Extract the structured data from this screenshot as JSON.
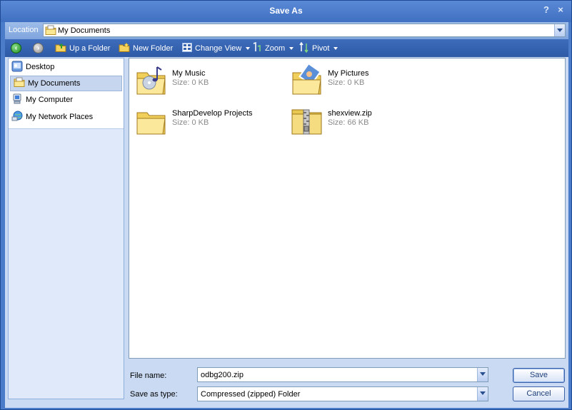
{
  "window": {
    "title": "Save As",
    "help_glyph": "?",
    "close_glyph": "×"
  },
  "location": {
    "label": "Location",
    "value": "My Documents"
  },
  "toolbar": {
    "up_folder": "Up a Folder",
    "new_folder": "New Folder",
    "change_view": "Change View",
    "zoom": "Zoom",
    "pivot": "Pivot"
  },
  "places": [
    {
      "label": "Desktop",
      "icon": "desktop-icon",
      "selected": false
    },
    {
      "label": "My Documents",
      "icon": "my-documents-icon",
      "selected": true
    },
    {
      "label": "My Computer",
      "icon": "my-computer-icon",
      "selected": false
    },
    {
      "label": "My Network Places",
      "icon": "network-places-icon",
      "selected": false
    }
  ],
  "files": [
    {
      "name": "My Music",
      "size": "Size: 0 KB",
      "icon": "music-folder-icon"
    },
    {
      "name": "My Pictures",
      "size": "Size: 0 KB",
      "icon": "pictures-folder-icon"
    },
    {
      "name": "SharpDevelop Projects",
      "size": "Size: 0 KB",
      "icon": "folder-icon"
    },
    {
      "name": "shexview.zip",
      "size": "Size: 66 KB",
      "icon": "zip-folder-icon"
    }
  ],
  "form": {
    "file_name_label": "File name:",
    "file_name_value": "odbg200.zip",
    "save_type_label": "Save as type:",
    "save_type_value": "Compressed (zipped) Folder"
  },
  "buttons": {
    "save": "Save",
    "cancel": "Cancel"
  },
  "colors": {
    "title_bar": "#4a7cc9",
    "toolbar": "#2e5aa6",
    "pane_bg": "#c9daf2"
  }
}
